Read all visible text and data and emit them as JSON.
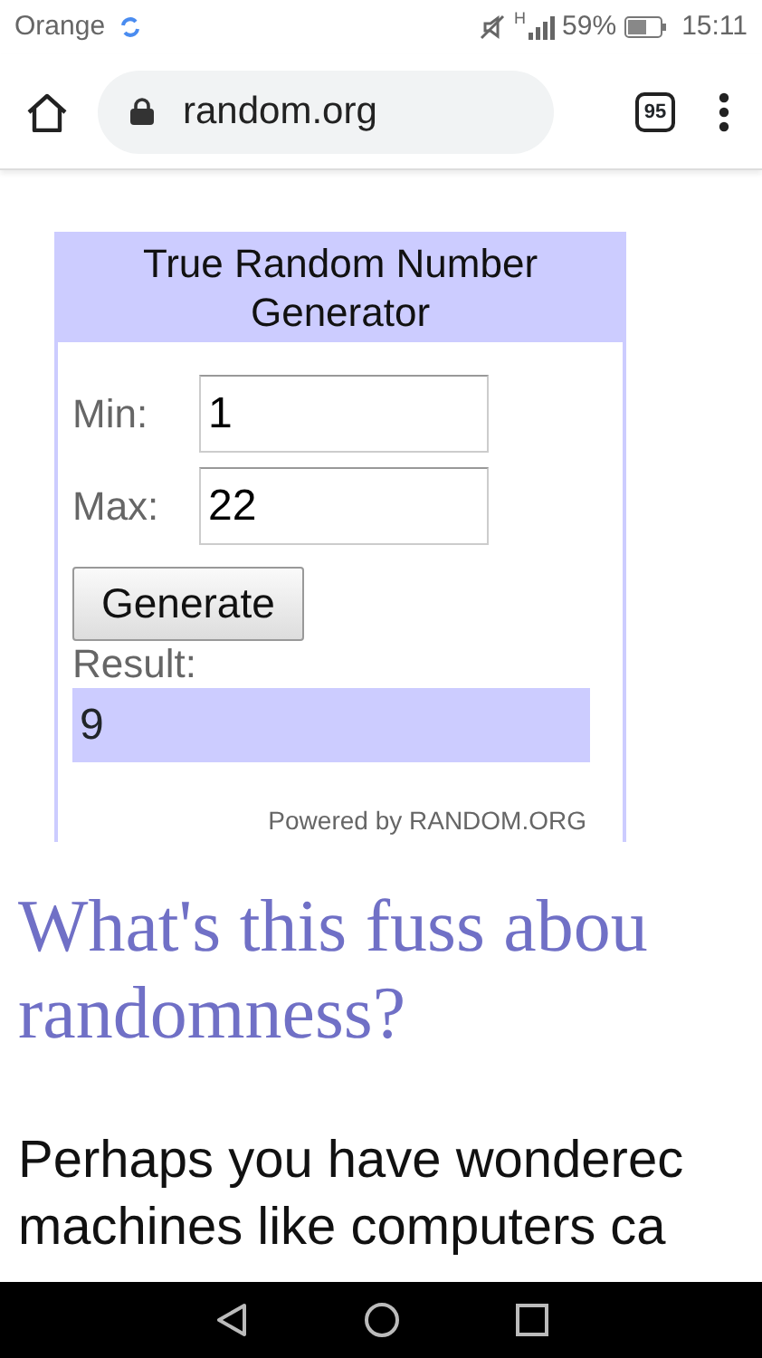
{
  "status_bar": {
    "carrier": "Orange",
    "network": "H",
    "battery": "59%",
    "time": "15:11"
  },
  "browser": {
    "url": "random.org",
    "tab_count": "95"
  },
  "widget": {
    "title": "True Random Number Generator",
    "fields": [
      {
        "label": "Min:",
        "value": "1"
      },
      {
        "label": "Max:",
        "value": "22"
      }
    ],
    "button": "Generate",
    "result_label": "Result:",
    "result": "9",
    "footer": "Powered by RANDOM.ORG"
  },
  "heading": [
    "What's this fuss abou",
    "randomness?"
  ],
  "paragraph": [
    "Perhaps you have wonderec",
    "machines like computers ca"
  ]
}
